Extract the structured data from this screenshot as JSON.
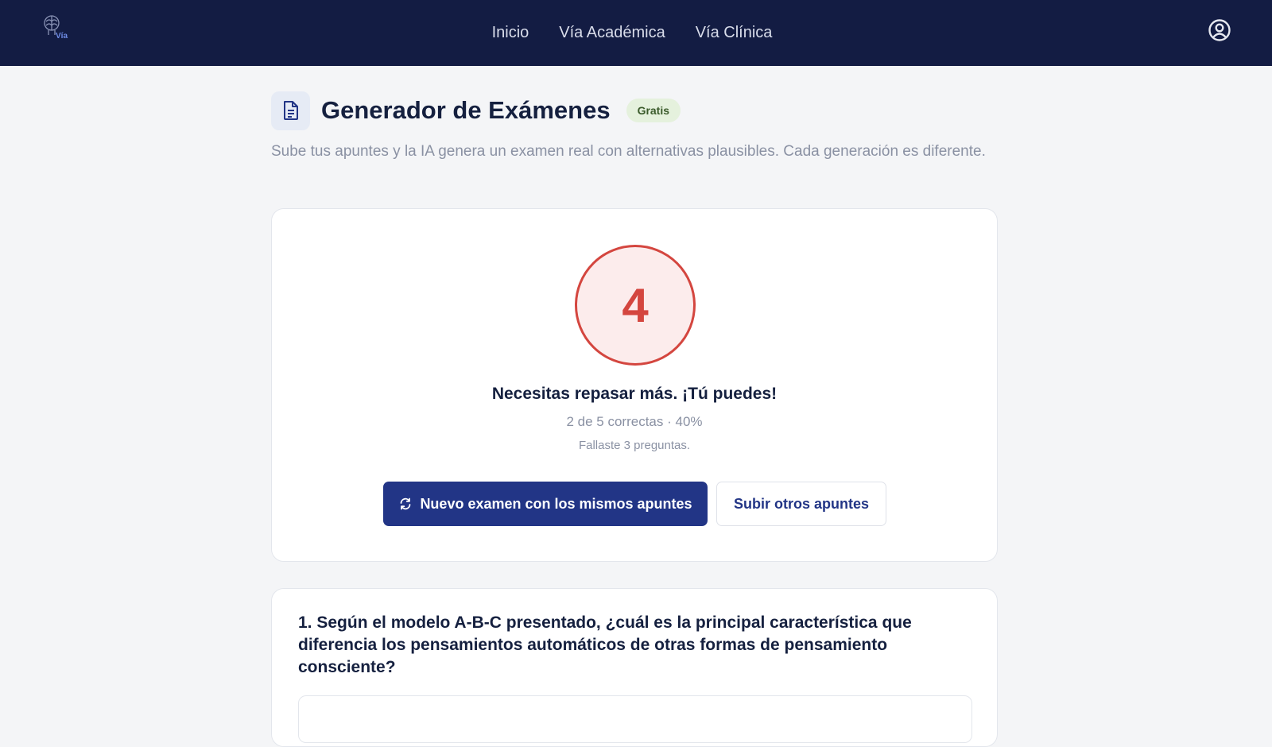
{
  "topbar": {
    "logo_text": "Vía",
    "nav": [
      "Inicio",
      "Vía Académica",
      "Vía Clínica"
    ]
  },
  "header": {
    "title": "Generador de Exámenes",
    "badge": "Gratis",
    "subtitle": "Sube tus apuntes y la IA genera un examen real con alternativas plausibles. Cada generación es diferente."
  },
  "result": {
    "score": "4",
    "message": "Necesitas repasar más. ¡Tú puedes!",
    "stats": "2 de 5 correctas · 40%",
    "note": "Fallaste 3 preguntas.",
    "new_exam_label": "Nuevo examen con los mismos apuntes",
    "upload_other_label": "Subir otros apuntes"
  },
  "questions": [
    {
      "text": "1. Según el modelo A-B-C presentado, ¿cuál es la principal característica que diferencia los pensamientos automáticos de otras formas de pensamiento consciente?"
    }
  ],
  "colors": {
    "topbar": "#131c43",
    "primary": "#223586",
    "score_red": "#d4463f",
    "score_bg": "#fcecec",
    "badge_bg": "#e5f1dd"
  },
  "icons": [
    "brain-logo-icon",
    "user-account-icon",
    "document-icon",
    "refresh-icon"
  ]
}
